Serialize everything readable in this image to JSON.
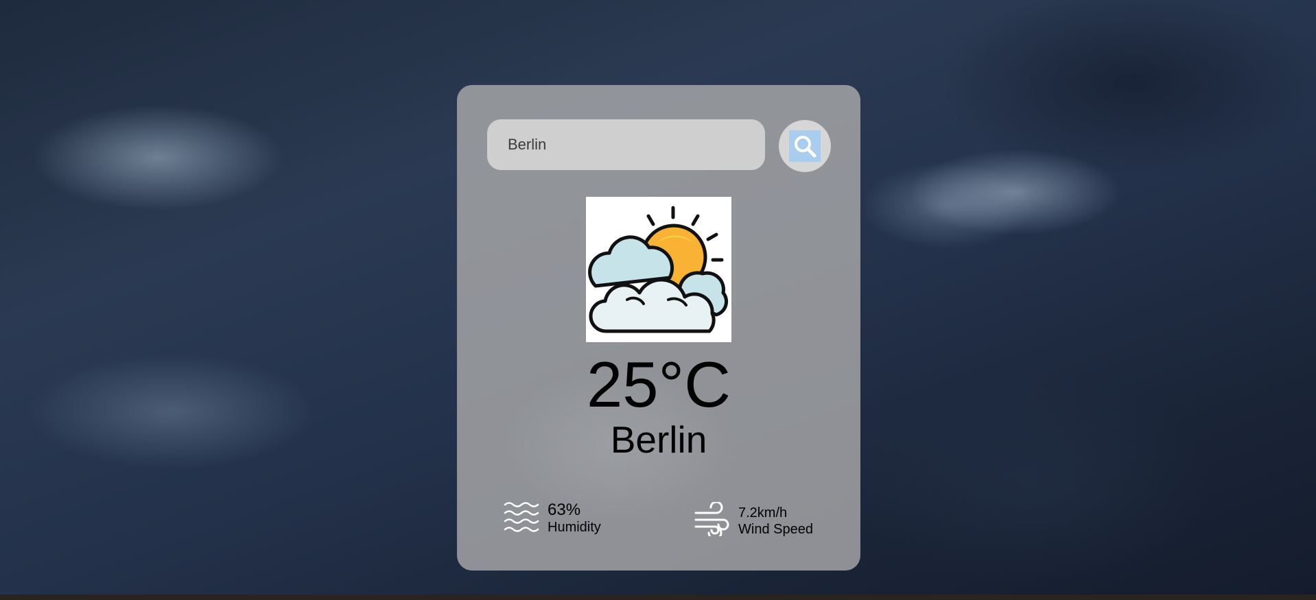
{
  "search": {
    "value": "Berlin"
  },
  "weather": {
    "icon": "partly-cloudy-icon",
    "temperature": "25°C",
    "city": "Berlin"
  },
  "details": {
    "humidity": {
      "value": "63%",
      "label": "Humidity",
      "icon": "humidity-waves-icon"
    },
    "wind": {
      "value": "7.2km/h",
      "label": "Wind Speed",
      "icon": "wind-icon"
    }
  },
  "colors": {
    "card": "#a8a8aa",
    "search_button_icon_bg": "#a8cdee",
    "sun": "#f9b233",
    "cloud": "#c6e3ea"
  }
}
